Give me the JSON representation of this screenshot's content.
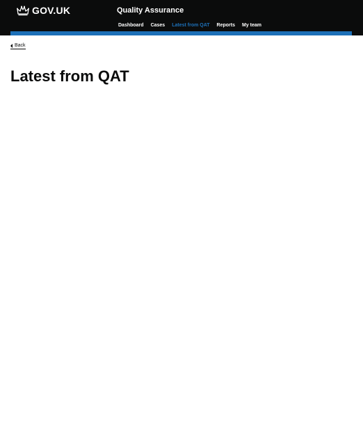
{
  "header": {
    "logo_text": "GOV.UK",
    "service_name": "Quality Assurance",
    "nav": [
      {
        "label": "Dashboard",
        "active": false
      },
      {
        "label": "Cases",
        "active": false
      },
      {
        "label": "Latest from QAT",
        "active": true
      },
      {
        "label": "Reports",
        "active": false
      },
      {
        "label": "My team",
        "active": false
      }
    ]
  },
  "back_link": {
    "label": "Back",
    "icon": "chevron-left-icon"
  },
  "main": {
    "title": "Latest from QAT"
  },
  "colors": {
    "header_bg": "#0b0c0c",
    "accent": "#1d70b8",
    "text": "#0b0c0c",
    "page_bg": "#ffffff"
  }
}
